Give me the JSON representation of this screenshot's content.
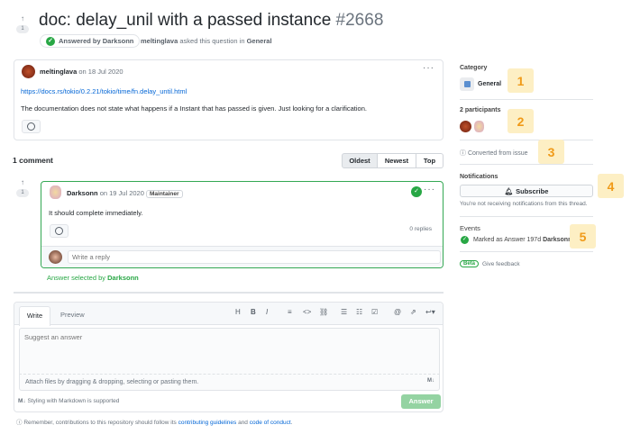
{
  "header": {
    "title": "doc: delay_unil with a passed instance",
    "number": "#2668",
    "votes": "1",
    "answered_label": "Answered by Darksonn",
    "author": "meltinglava",
    "asked_text": "asked this question in",
    "category": "General"
  },
  "post": {
    "author": "meltinglava",
    "date": "on 18 Jul 2020",
    "link": "https://docs.rs/tokio/0.2.21/tokio/time/fn.delay_until.html",
    "body": "The documentation does not state what happens if a Instant that has passed is given. Just looking for a clarification."
  },
  "comments": {
    "count_label": "1 comment",
    "sort": [
      "Oldest",
      "Newest",
      "Top"
    ],
    "selected_sort": "Oldest"
  },
  "answer": {
    "votes": "1",
    "author": "Darksonn",
    "date": "on 19 Jul 2020",
    "badge": "Maintainer",
    "body": "It should complete immediately.",
    "replies": "0 replies",
    "reply_placeholder": "Write a reply",
    "selected_prefix": "Answer selected by",
    "selected_by": "Darksonn"
  },
  "editor": {
    "tabs": [
      "Write",
      "Preview"
    ],
    "active_tab": "Write",
    "toolbar": [
      "H",
      "B",
      "I",
      "quote",
      "code",
      "link",
      "bullet-list",
      "numbered-list",
      "task-list",
      "mention",
      "reference",
      "reply"
    ],
    "placeholder": "Suggest an answer",
    "attach": "Attach files by dragging & dropping, selecting or pasting them.",
    "markdown": "Styling with Markdown is supported",
    "submit": "Answer"
  },
  "footer": {
    "prefix": "Remember, contributions to this repository should follow its",
    "link1": "contributing guidelines",
    "and": "and",
    "link2": "code of conduct",
    "suffix": "."
  },
  "sidebar": {
    "category_label": "Category",
    "category": "General",
    "participants_label": "2 participants",
    "converted": "Converted from issue",
    "notifications_label": "Notifications",
    "subscribe": "Subscribe",
    "not_receiving": "You're not receiving notifications from this thread.",
    "events_label": "Events",
    "event_text": "Marked as Answer 197d",
    "event_user": "Darksonn",
    "beta": "Beta",
    "feedback": "Give feedback"
  },
  "markers": [
    "1",
    "2",
    "3",
    "4",
    "5"
  ],
  "colors": {
    "green": "#28a745",
    "link": "#0366d6",
    "marker_bg": "#fdefc4",
    "marker_text": "#f09a18"
  }
}
